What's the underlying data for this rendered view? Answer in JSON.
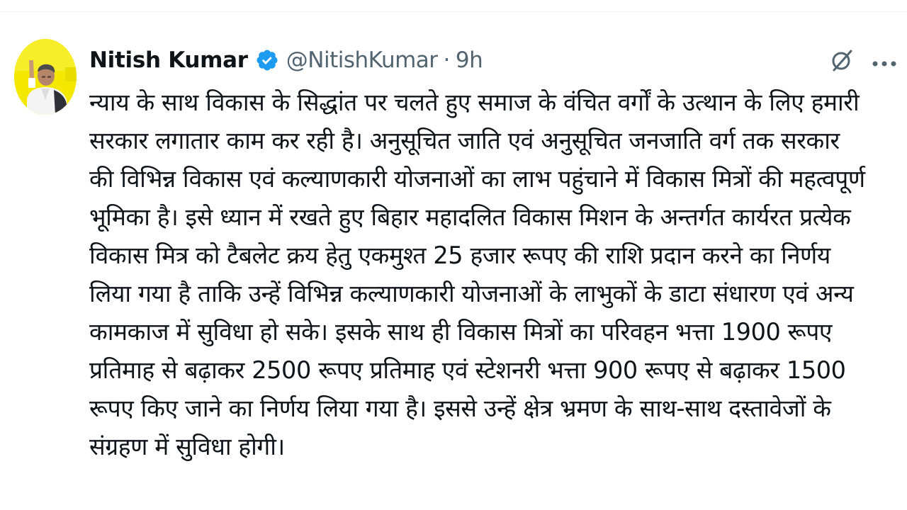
{
  "tweet": {
    "display_name": "Nitish Kumar",
    "handle": "@NitishKumar",
    "separator": "·",
    "time": "9h",
    "verified": true,
    "lines": [
      "न्याय के साथ विकास के सिद्धांत पर चलते हुए समाज के वंचित वर्गों के उत्थान के लिए हमारी",
      "सरकार लगातार काम कर रही है। अनुसूचित जाति एवं अनुसूचित जनजाति वर्ग तक सरकार",
      "की विभिन्न विकास एवं कल्याणकारी योजनाओं का लाभ पहुंचाने में विकास मित्रों की महत्वपूर्ण",
      "भूमिका है। इसे ध्यान में रखते हुए बिहार महादलित विकास मिशन के अन्तर्गत कार्यरत प्रत्येक",
      "विकास मित्र को टैबलेट क्रय हेतु एकमुश्त 25 हजार रूपए की राशि प्रदान करने का निर्णय",
      "लिया गया है ताकि उन्हें विभिन्न कल्याणकारी योजनाओं के लाभुकों के डाटा संधारण एवं अन्य",
      "कामकाज में सुविधा हो सके। इसके साथ ही विकास मित्रों का परिवहन भत्ता 1900 रूपए",
      "प्रतिमाह से बढ़ाकर 2500 रूपए प्रतिमाह एवं स्टेशनरी भत्ता 900 रूपए से बढ़ाकर 1500",
      "रूपए किए जाने का निर्णय लिया गया है। इससे उन्हें क्षेत्र भ्रमण के साथ-साथ दस्तावेजों के",
      "संग्रहण में सुविधा होगी।"
    ]
  },
  "icons": {
    "avatar": "profile-photo",
    "verified": "verified-badge-icon",
    "grok": "grok-icon",
    "more": "more-icon"
  },
  "colors": {
    "text": "#0f1419",
    "secondary": "#536471",
    "verified": "#1d9bf0",
    "avatar_bg": "#f2e600"
  }
}
